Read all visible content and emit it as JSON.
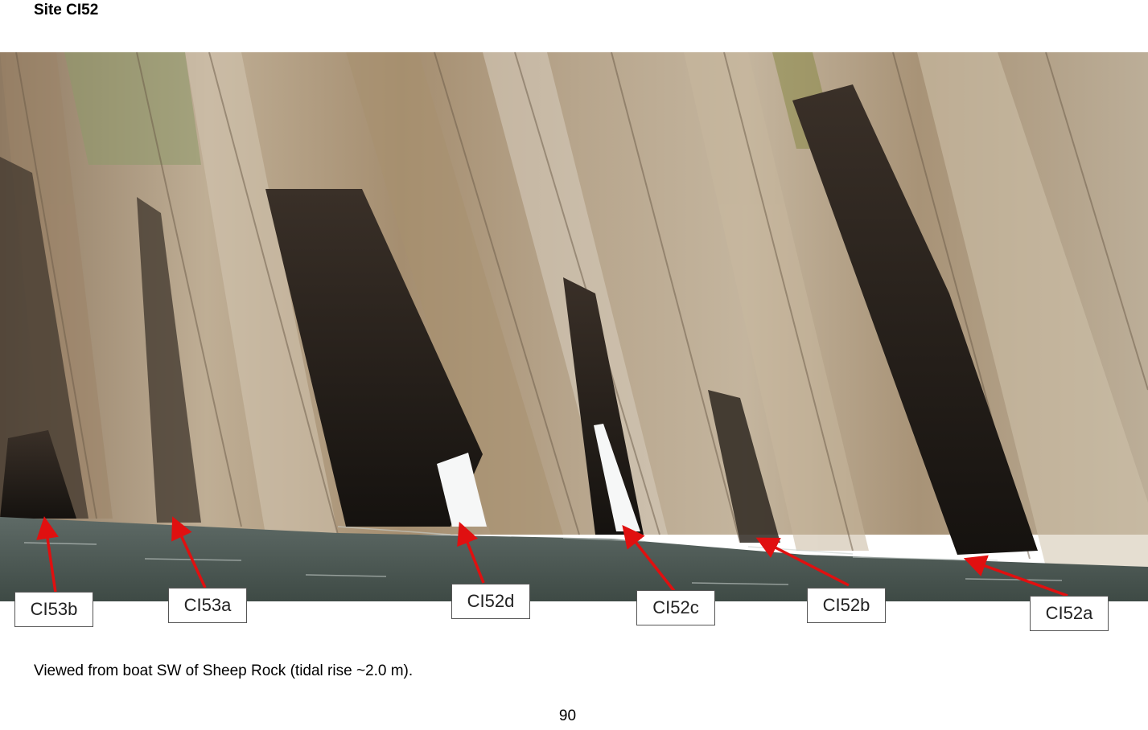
{
  "document": {
    "site_title": "Site CI52",
    "caption": "Viewed from boat SW of Sheep Rock (tidal rise ~2.0 m).",
    "page_number": "90"
  },
  "photo_labels": [
    {
      "id": "ci53b",
      "text": "CI53b"
    },
    {
      "id": "ci53a",
      "text": "CI53a"
    },
    {
      "id": "ci52d",
      "text": "CI52d"
    },
    {
      "id": "ci52c",
      "text": "CI52c"
    },
    {
      "id": "ci52b",
      "text": "CI52b"
    },
    {
      "id": "ci52a",
      "text": "CI52a"
    }
  ],
  "colors": {
    "arrow": "#e01010",
    "water": "#4a5650",
    "rock_light": "#b9a68a",
    "rock_dark": "#2a241f"
  }
}
